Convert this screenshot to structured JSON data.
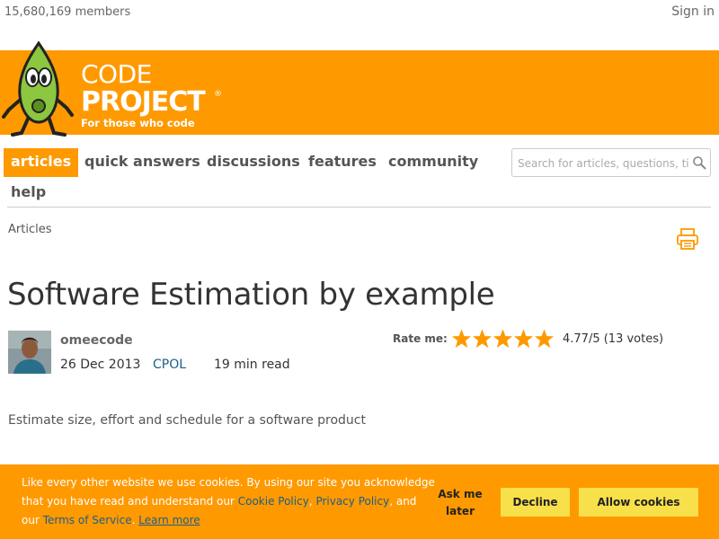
{
  "header": {
    "members": "15,680,169 members",
    "sign_in": "Sign in"
  },
  "logo": {
    "line1": "CODE",
    "line2": "PROJECT",
    "registered": "®",
    "tagline": "For those who code"
  },
  "nav": {
    "items": [
      {
        "label": "articles",
        "active": true
      },
      {
        "label": "quick answers",
        "active": false
      },
      {
        "label": "discussions",
        "active": false
      },
      {
        "label": "features",
        "active": false
      },
      {
        "label": "community",
        "active": false
      },
      {
        "label": "help",
        "active": false
      }
    ],
    "search_placeholder": "Search for articles, questions, tips"
  },
  "breadcrumb": "Articles",
  "article": {
    "title": "Software Estimation by example",
    "author": "omeecode",
    "date": "26 Dec 2013",
    "license": "CPOL",
    "read_time": "19 min read",
    "rate_label": "Rate me:",
    "rating": "4.77/5 (13 votes)",
    "rating_value": 4.77,
    "rating_max": 5,
    "summary": "Estimate size, effort and schedule for a software product"
  },
  "cookie": {
    "text_1": "Like every other website we use cookies. By using our site you acknowledge that you have read and understand our ",
    "cookie_policy": "Cookie Policy",
    "sep_1": ", ",
    "privacy_policy": "Privacy Policy",
    "text_2": ", and our ",
    "terms": "Terms of Service",
    "sep_2": ". ",
    "learn_more": "Learn more",
    "ask_later": "Ask me later",
    "decline": "Decline",
    "allow": "Allow cookies"
  },
  "colors": {
    "brand_orange": "#ff9900",
    "button_yellow": "#f7e04a",
    "link_blue": "#1a5e8a"
  },
  "icons": [
    "search-icon",
    "print-icon",
    "star-icon",
    "mascot-logo"
  ]
}
